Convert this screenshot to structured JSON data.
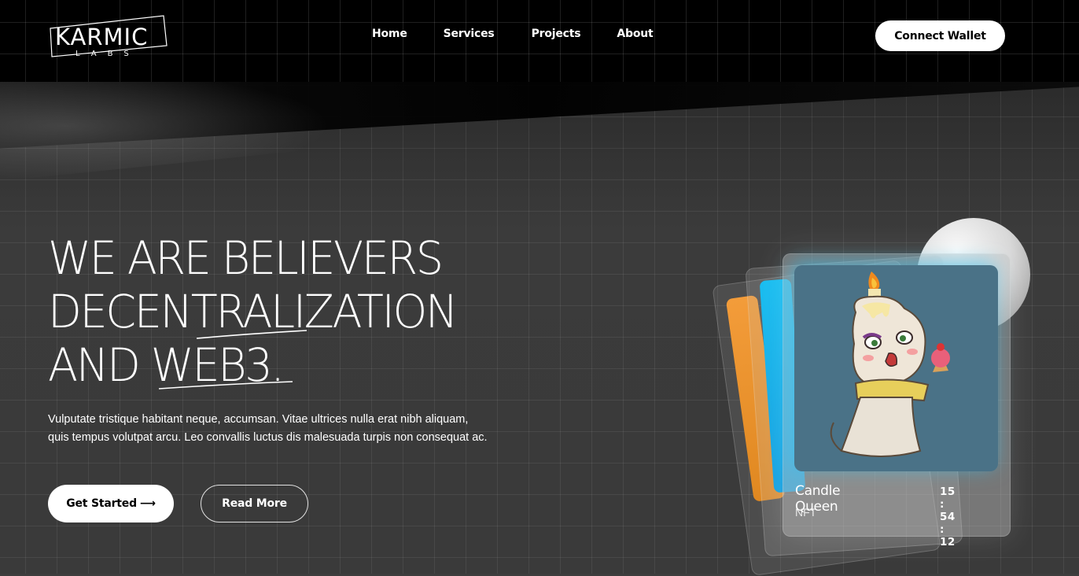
{
  "brand": {
    "logo_main": "KARMIC",
    "logo_sub": "LABS"
  },
  "nav": {
    "items": [
      {
        "label": "Home"
      },
      {
        "label": "Services"
      },
      {
        "label": "Projects"
      },
      {
        "label": "About"
      }
    ],
    "connect_label": "Connect Wallet"
  },
  "hero": {
    "title_lines": [
      "WE ARE BELIEVERS",
      "DECENTRALIZATION",
      "AND WEB3."
    ],
    "description": "Vulputate tristique habitant neque, accumsan. Vitae ultrices nulla erat nibh aliquam, quis tempus volutpat arcu. Leo convallis luctus dis malesuada turpis non consequat ac.",
    "primary_button": "Get Started",
    "primary_arrow": "⟶",
    "secondary_button": "Read More"
  },
  "nft_card": {
    "name": "Candle Queen",
    "type": "NFT",
    "timer": "15 : 54 : 12",
    "image_icon": "candle-queen-illustration"
  },
  "colors": {
    "background": "#3d3d3d",
    "header": "#000000",
    "card_orange": "#f39c3a",
    "card_blue": "#18bdf0",
    "nft_bg": "#4a7287"
  }
}
